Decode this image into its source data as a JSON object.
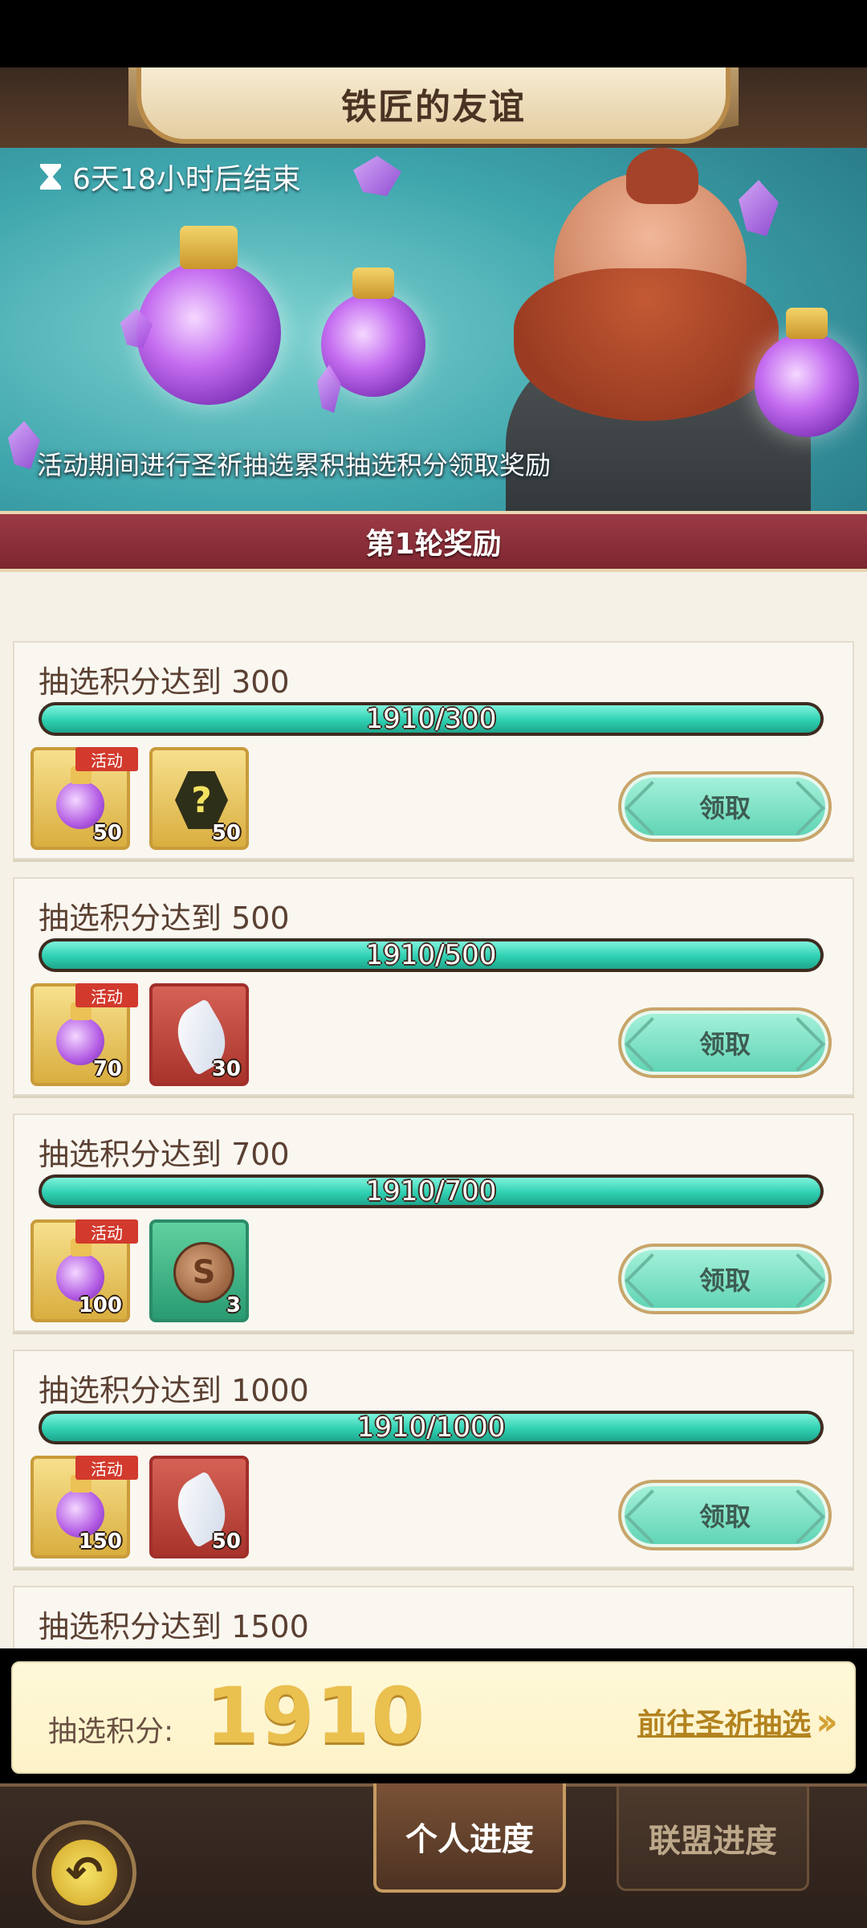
{
  "banner": {
    "title": "铁匠的友谊",
    "timer": "6天18小时后结束",
    "description": "活动期间进行圣祈抽选累积抽选积分领取奖励"
  },
  "round": {
    "title": "第1轮奖励"
  },
  "rewards": [
    {
      "title": "抽选积分达到 300",
      "progress_text": "1910/300",
      "progress_fraction": 1.0,
      "items": [
        {
          "kind": "potion",
          "count": "50",
          "badge": "活动",
          "frame": "gold"
        },
        {
          "kind": "mystery",
          "count": "50",
          "badge": "",
          "frame": "gold"
        }
      ],
      "claim_label": "领取"
    },
    {
      "title": "抽选积分达到 500",
      "progress_text": "1910/500",
      "progress_fraction": 1.0,
      "items": [
        {
          "kind": "potion",
          "count": "70",
          "badge": "活动",
          "frame": "gold"
        },
        {
          "kind": "feather",
          "count": "30",
          "badge": "",
          "frame": "red"
        }
      ],
      "claim_label": "领取"
    },
    {
      "title": "抽选积分达到 700",
      "progress_text": "1910/700",
      "progress_fraction": 1.0,
      "items": [
        {
          "kind": "potion",
          "count": "100",
          "badge": "活动",
          "frame": "gold"
        },
        {
          "kind": "coin",
          "count": "3",
          "badge": "",
          "frame": "green"
        }
      ],
      "claim_label": "领取"
    },
    {
      "title": "抽选积分达到 1000",
      "progress_text": "1910/1000",
      "progress_fraction": 1.0,
      "items": [
        {
          "kind": "potion",
          "count": "150",
          "badge": "活动",
          "frame": "gold"
        },
        {
          "kind": "feather",
          "count": "50",
          "badge": "",
          "frame": "red"
        }
      ],
      "claim_label": "领取"
    },
    {
      "title": "抽选积分达到 1500"
    }
  ],
  "score": {
    "label": "抽选积分:",
    "value": "1910",
    "goto_label": "前往圣祈抽选"
  },
  "nav": {
    "tabs": [
      {
        "label": "个人进度",
        "active": true
      },
      {
        "label": "联盟进度",
        "active": false
      }
    ]
  },
  "colors": {
    "progress": "#2fd0b2",
    "header": "#9c3a45",
    "score": "#eac04f"
  }
}
